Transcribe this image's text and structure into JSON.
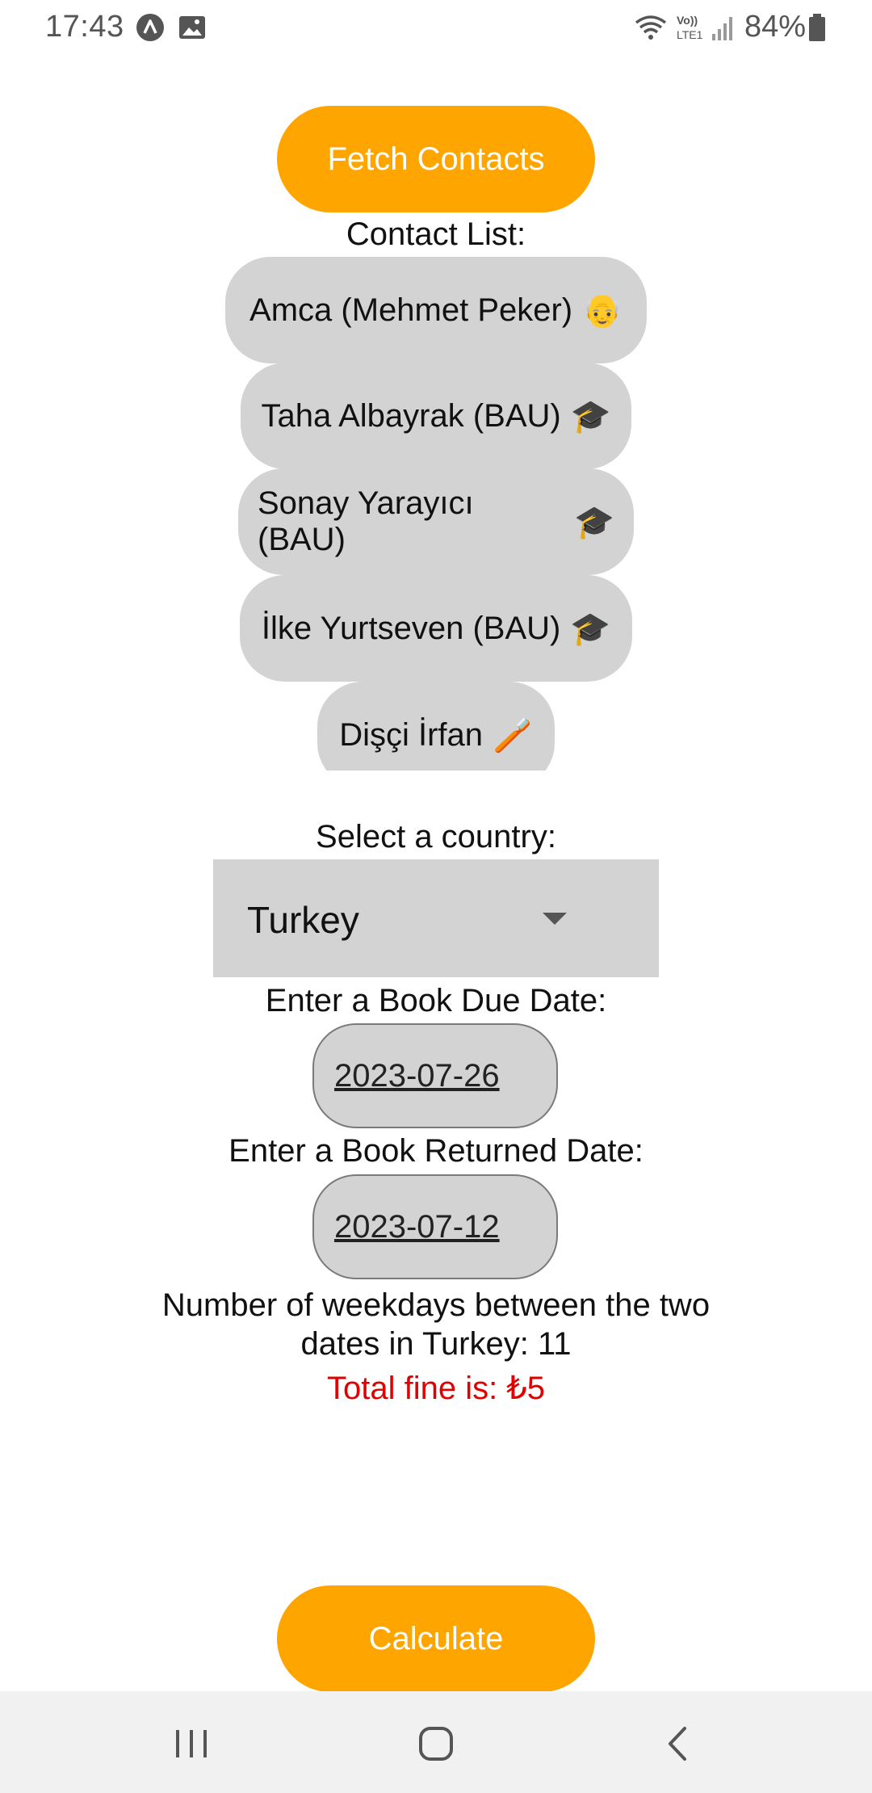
{
  "status_bar": {
    "time": "17:43",
    "battery": "84%",
    "icons": [
      "app-notification-icon",
      "image-notification-icon",
      "wifi-icon",
      "volte-icon",
      "signal-icon",
      "battery-icon"
    ]
  },
  "fetch_button": {
    "label": "Fetch Contacts"
  },
  "contacts": {
    "heading": "Contact List:",
    "items": [
      {
        "name": "Amca (Mehmet Peker)",
        "emoji": "👴"
      },
      {
        "name": "Taha Albayrak (BAU)",
        "emoji": "🎓"
      },
      {
        "name": "Sonay Yarayıcı (BAU)",
        "emoji": "🎓"
      },
      {
        "name": "İlke Yurtseven (BAU)",
        "emoji": "🎓"
      },
      {
        "name": "Dişçi İrfan",
        "emoji": "🪥"
      }
    ]
  },
  "country": {
    "label": "Select a country:",
    "selected": "Turkey"
  },
  "due_date": {
    "label": "Enter a Book Due Date:",
    "value": "2023-07-26"
  },
  "returned_date": {
    "label": "Enter a Book Returned Date:",
    "value": "2023-07-12"
  },
  "result": {
    "weekdays_text": "Number of weekdays between the two dates in Turkey: 11",
    "fine_text": "Total fine is: ₺5"
  },
  "calculate_button": {
    "label": "Calculate"
  },
  "colors": {
    "accent": "#ffa500",
    "item_bg": "#d3d3d3",
    "fine": "#e00000"
  }
}
